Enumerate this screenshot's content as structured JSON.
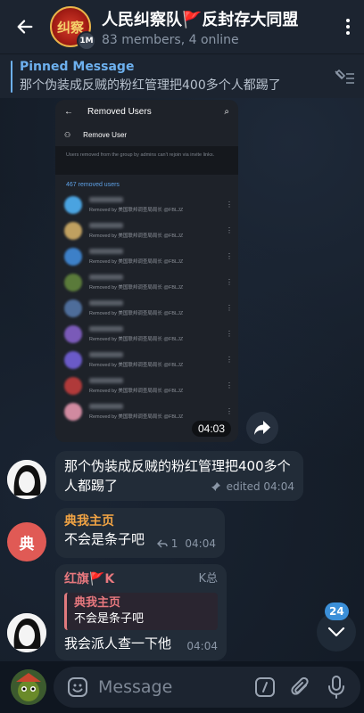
{
  "header": {
    "title": "人民纠察队🚩反封存大同盟",
    "subtitle": "83 members, 4 online",
    "avatar_text": "纠察",
    "avatar_badge": "1M"
  },
  "pinned": {
    "label": "Pinned Message",
    "text": "那个伪装成反贼的粉红管理把400多个人都踢了"
  },
  "screenshot": {
    "title": "Removed Users",
    "remove_user": "Remove User",
    "note": "Users removed from the group by admins can't rejoin via invite links.",
    "count_label": "467 removed users",
    "removed_by": "Removed by 美国联邦调查局局长 @FBLJZ",
    "items": [
      {
        "color": "#4aa3e0"
      },
      {
        "color": "#c0a060"
      },
      {
        "color": "#3d80c8"
      },
      {
        "color": "#5a7a3a"
      },
      {
        "color": "#4e6d9a"
      },
      {
        "color": "#7a5ab8"
      },
      {
        "color": "#6a5ac8"
      },
      {
        "color": "#b03a3a"
      },
      {
        "color": "#d08aa0"
      }
    ],
    "time": "04:03"
  },
  "messages": [
    {
      "text": "那个伪装成反贼的粉红管理把400多个人都踢了",
      "meta": "edited 04:04"
    },
    {
      "author": "典我主页",
      "avatar_letter": "典",
      "text": "不会是条子吧",
      "replies": "1",
      "time": "04:04"
    },
    {
      "author": "红旗🚩K",
      "admin_title": "K总",
      "reply_author": "典我主页",
      "reply_text": "不会是条子吧",
      "text": "我会派人查一下他",
      "time": "04:04"
    }
  ],
  "unread_count": "24",
  "input": {
    "placeholder": "Message"
  },
  "colors": {
    "accent": "#6db0ee",
    "bubble": "#222c38",
    "author_orange": "#f2a444",
    "author_pink": "#e7787e",
    "avatar_red": "#e05a55"
  }
}
